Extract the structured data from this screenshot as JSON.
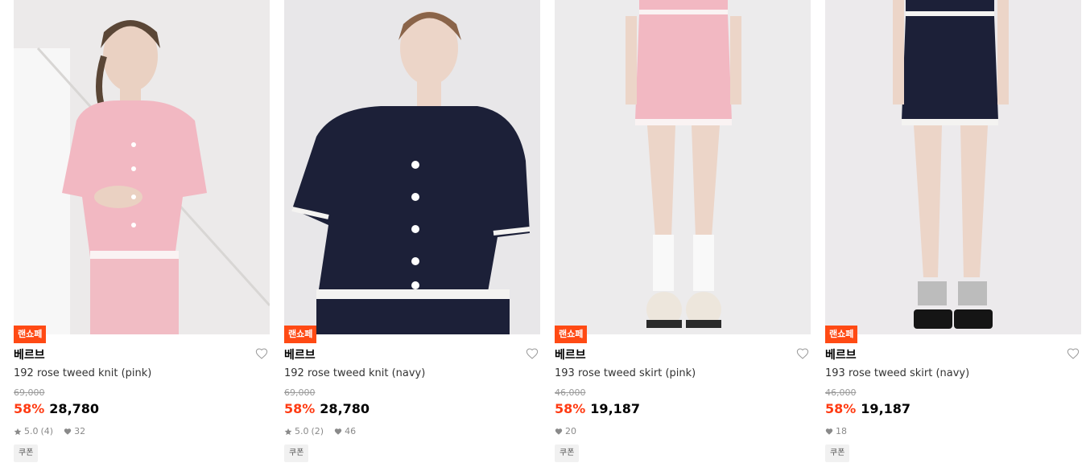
{
  "products": [
    {
      "tag": "랜쇼페",
      "brand": "베르브",
      "name": "192 rose tweed knit (pink)",
      "original_price": "69,000",
      "discount": "58%",
      "sale_price": "28,780",
      "rating": "5.0",
      "review_count": "(4)",
      "likes": "32",
      "coupon": "쿠폰",
      "photo": "model-in-pink-tweed-cardigan",
      "garment_color": "#f2b8c2"
    },
    {
      "tag": "랜쇼페",
      "brand": "베르브",
      "name": "192 rose tweed knit (navy)",
      "original_price": "69,000",
      "discount": "58%",
      "sale_price": "28,780",
      "rating": "5.0",
      "review_count": "(2)",
      "likes": "46",
      "coupon": "쿠폰",
      "photo": "model-in-navy-tweed-cardigan",
      "garment_color": "#1c2038"
    },
    {
      "tag": "랜쇼페",
      "brand": "베르브",
      "name": "193 rose tweed skirt (pink)",
      "original_price": "46,000",
      "discount": "58%",
      "sale_price": "19,187",
      "likes": "20",
      "coupon": "쿠폰",
      "photo": "model-in-pink-tweed-skirt",
      "garment_color": "#f2b8c2"
    },
    {
      "tag": "랜쇼페",
      "brand": "베르브",
      "name": "193 rose tweed skirt (navy)",
      "original_price": "46,000",
      "discount": "58%",
      "sale_price": "19,187",
      "likes": "18",
      "coupon": "쿠폰",
      "photo": "model-in-navy-tweed-skirt",
      "garment_color": "#1c2038"
    }
  ],
  "colors": {
    "tag_bg": "#ff4a14",
    "discount": "#ff3b13",
    "muted": "#8a8a8a"
  }
}
